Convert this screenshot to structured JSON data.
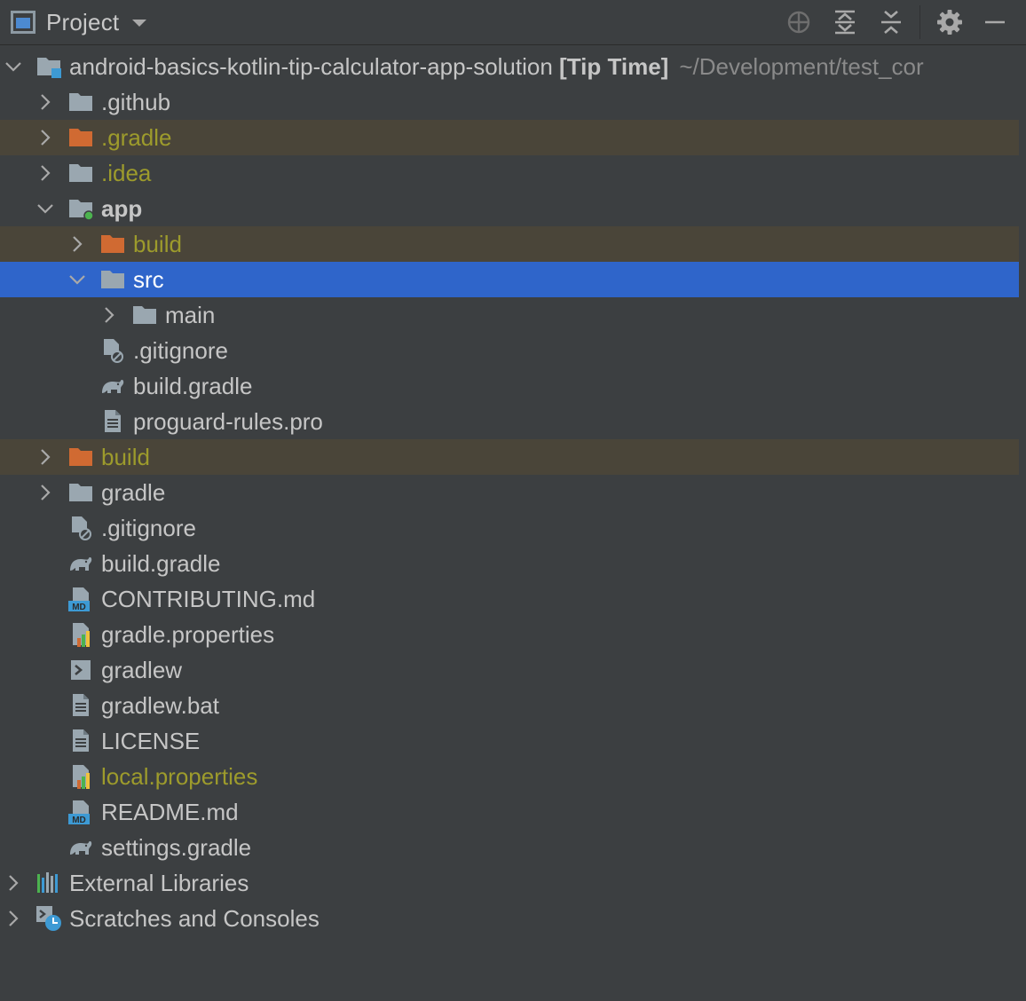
{
  "panel": {
    "title": "Project",
    "buttons": [
      "locate-icon",
      "expand-all-icon",
      "collapse-all-icon",
      "gear-icon",
      "minimize-icon"
    ]
  },
  "tree": {
    "root": {
      "name": "android-basics-kotlin-tip-calculator-app-solution",
      "tag": "[Tip Time]",
      "path": "~/Development/test_cor"
    },
    "items": [
      {
        "label": ".github"
      },
      {
        "label": ".gradle"
      },
      {
        "label": ".idea"
      },
      {
        "label": "app"
      },
      {
        "label": "build"
      },
      {
        "label": "src"
      },
      {
        "label": "main"
      },
      {
        "label": ".gitignore"
      },
      {
        "label": "build.gradle"
      },
      {
        "label": "proguard-rules.pro"
      },
      {
        "label": "build"
      },
      {
        "label": "gradle"
      },
      {
        "label": ".gitignore"
      },
      {
        "label": "build.gradle"
      },
      {
        "label": "CONTRIBUTING.md"
      },
      {
        "label": "gradle.properties"
      },
      {
        "label": "gradlew"
      },
      {
        "label": "gradlew.bat"
      },
      {
        "label": "LICENSE"
      },
      {
        "label": "local.properties"
      },
      {
        "label": "README.md"
      },
      {
        "label": "settings.gradle"
      },
      {
        "label": "External Libraries"
      },
      {
        "label": "Scratches and Consoles"
      }
    ]
  },
  "colors": {
    "background": "#3c3f41",
    "selection": "#2f65ca",
    "excluded_row": "#4a4539",
    "excluded_folder": "#d06a32",
    "folder": "#9aa7b0",
    "olive_text": "#9d9b2c",
    "module_dot": "#4cb34f"
  }
}
